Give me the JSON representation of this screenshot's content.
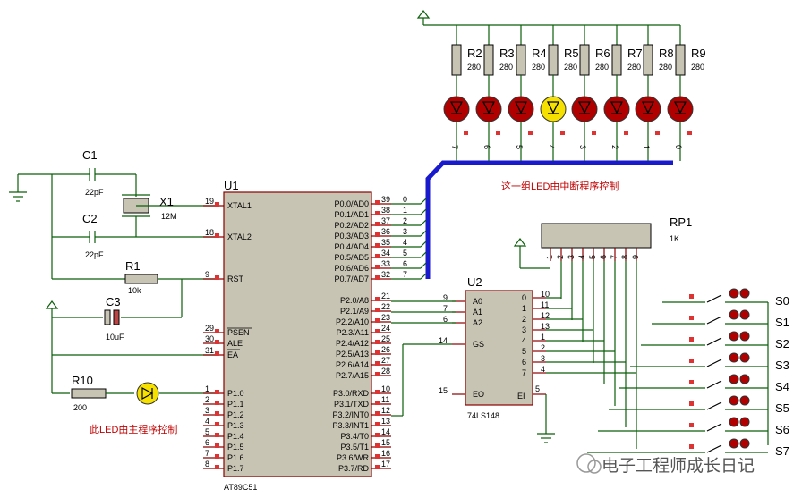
{
  "mcu": {
    "ref": "U1",
    "part": "AT89C51",
    "left_pins": [
      {
        "num": "19",
        "name": "XTAL1"
      },
      {
        "num": "18",
        "name": "XTAL2"
      },
      {
        "num": "9",
        "name": "RST"
      },
      {
        "num": "29",
        "name": "PSEN"
      },
      {
        "num": "30",
        "name": "ALE"
      },
      {
        "num": "31",
        "name": "EA"
      },
      {
        "num": "1",
        "name": "P1.0"
      },
      {
        "num": "2",
        "name": "P1.1"
      },
      {
        "num": "3",
        "name": "P1.2"
      },
      {
        "num": "4",
        "name": "P1.3"
      },
      {
        "num": "5",
        "name": "P1.4"
      },
      {
        "num": "6",
        "name": "P1.5"
      },
      {
        "num": "7",
        "name": "P1.6"
      },
      {
        "num": "8",
        "name": "P1.7"
      }
    ],
    "right_pins": [
      {
        "num": "39",
        "name": "P0.0/AD0"
      },
      {
        "num": "38",
        "name": "P0.1/AD1"
      },
      {
        "num": "37",
        "name": "P0.2/AD2"
      },
      {
        "num": "36",
        "name": "P0.3/AD3"
      },
      {
        "num": "35",
        "name": "P0.4/AD4"
      },
      {
        "num": "34",
        "name": "P0.5/AD5"
      },
      {
        "num": "33",
        "name": "P0.6/AD6"
      },
      {
        "num": "32",
        "name": "P0.7/AD7"
      },
      {
        "num": "21",
        "name": "P2.0/A8"
      },
      {
        "num": "22",
        "name": "P2.1/A9"
      },
      {
        "num": "23",
        "name": "P2.2/A10"
      },
      {
        "num": "24",
        "name": "P2.3/A11"
      },
      {
        "num": "25",
        "name": "P2.4/A12"
      },
      {
        "num": "26",
        "name": "P2.5/A13"
      },
      {
        "num": "27",
        "name": "P2.6/A14"
      },
      {
        "num": "28",
        "name": "P2.7/A15"
      },
      {
        "num": "10",
        "name": "P3.0/RXD"
      },
      {
        "num": "11",
        "name": "P3.1/TXD"
      },
      {
        "num": "12",
        "name": "P3.2/INT0"
      },
      {
        "num": "13",
        "name": "P3.3/INT1"
      },
      {
        "num": "14",
        "name": "P3.4/T0"
      },
      {
        "num": "15",
        "name": "P3.5/T1"
      },
      {
        "num": "16",
        "name": "P3.6/WR"
      },
      {
        "num": "17",
        "name": "P3.7/RD"
      }
    ],
    "bus_indices": [
      "0",
      "1",
      "2",
      "3",
      "4",
      "5",
      "6",
      "7"
    ]
  },
  "encoder": {
    "ref": "U2",
    "part": "74LS148",
    "left_pins": [
      {
        "num": "9",
        "name": "A0"
      },
      {
        "num": "7",
        "name": "A1"
      },
      {
        "num": "6",
        "name": "A2"
      },
      {
        "num": "14",
        "name": "GS"
      },
      {
        "num": "15",
        "name": "EO"
      }
    ],
    "right_pins": [
      {
        "num": "10",
        "name": "0"
      },
      {
        "num": "11",
        "name": "1"
      },
      {
        "num": "12",
        "name": "2"
      },
      {
        "num": "13",
        "name": "3"
      },
      {
        "num": "1",
        "name": "4"
      },
      {
        "num": "2",
        "name": "5"
      },
      {
        "num": "3",
        "name": "6"
      },
      {
        "num": "4",
        "name": "7"
      }
    ],
    "ei": {
      "num": "5",
      "name": "EI"
    }
  },
  "components": {
    "c1": {
      "ref": "C1",
      "value": "22pF"
    },
    "c2": {
      "ref": "C2",
      "value": "22pF"
    },
    "x1": {
      "ref": "X1",
      "value": "12M"
    },
    "r1": {
      "ref": "R1",
      "value": "10k"
    },
    "c3": {
      "ref": "C3",
      "value": "10uF"
    },
    "r10": {
      "ref": "R10",
      "value": "200"
    },
    "rp1": {
      "ref": "RP1",
      "value": "1K",
      "pins": [
        "1",
        "2",
        "3",
        "4",
        "5",
        "6",
        "7",
        "8",
        "9"
      ]
    }
  },
  "led_resistors": [
    {
      "ref": "R2",
      "value": "280",
      "net": "7"
    },
    {
      "ref": "R3",
      "value": "280",
      "net": "6"
    },
    {
      "ref": "R4",
      "value": "280",
      "net": "5"
    },
    {
      "ref": "R5",
      "value": "280",
      "net": "4"
    },
    {
      "ref": "R6",
      "value": "280",
      "net": "3"
    },
    {
      "ref": "R7",
      "value": "280",
      "net": "2"
    },
    {
      "ref": "R8",
      "value": "280",
      "net": "1"
    },
    {
      "ref": "R9",
      "value": "280",
      "net": "0"
    }
  ],
  "led_lit_index": 3,
  "colors": {
    "led_off": "#b00000",
    "led_on": "#f5e000",
    "wire": "#0a5f0a",
    "bus": "#1a1acd",
    "pin": "#8b0000",
    "chip_fill": "#c8c4b4"
  },
  "switches": [
    "S0",
    "S1",
    "S2",
    "S3",
    "S4",
    "S5",
    "S6",
    "S7"
  ],
  "notes": {
    "interrupt": "这一组LED由中断程序控制",
    "main": "此LED由主程序控制"
  },
  "watermark": "电子工程师成长日记"
}
